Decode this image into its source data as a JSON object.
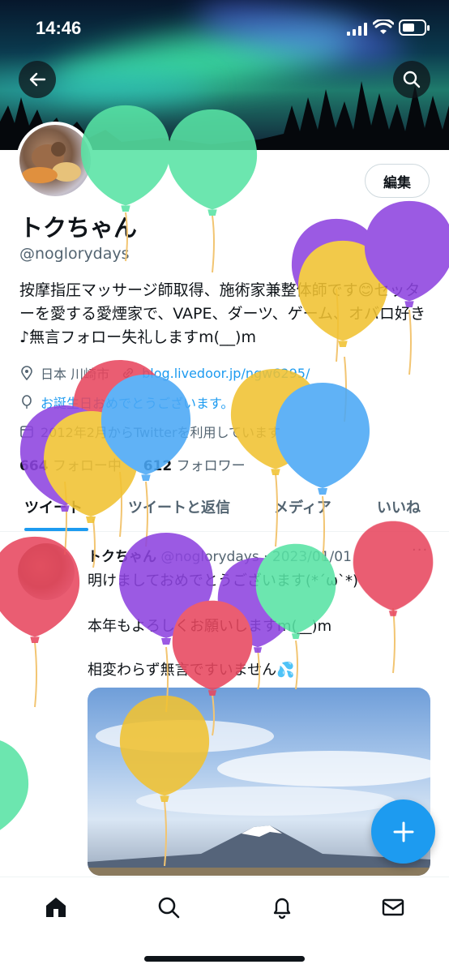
{
  "status_bar": {
    "time": "14:46"
  },
  "profile": {
    "edit_label": "編集",
    "name": "トクちゃん",
    "handle": "@noglorydays",
    "bio": "按摩指圧マッサージ師取得、施術家兼整体師です😊セッターを愛する愛煙家で、VAPE、ダーツ、ゲーム、オバロ好き♪無言フォロー失礼しますm(__)m",
    "location": "日本 川崎市",
    "website": "blog.livedoor.jp/ngw6295/",
    "birthday": "お誕生日おめでとうございます。",
    "joined": "2012年2月からTwitterを利用しています",
    "following_count": "664",
    "following_label": "フォロー中",
    "followers_count": "612",
    "followers_label": "フォロワー"
  },
  "tabs": [
    {
      "label": "ツイート"
    },
    {
      "label": "ツイートと返信"
    },
    {
      "label": "メディア"
    },
    {
      "label": "いいね"
    }
  ],
  "tweet": {
    "author": "トクちゃん",
    "handle": "@noglorydays",
    "date": "2023/01/01",
    "more": "···",
    "lines": [
      "明けましておめでとうございます(*´ω`*)",
      "本年もよろしくお願いしますm(__)m",
      "相変わらず無言ですいません💦"
    ]
  },
  "icons": {
    "back": "arrow-left-icon",
    "search": "search-icon",
    "location": "location-pin-icon",
    "link": "link-icon",
    "birthday": "balloon-icon",
    "calendar": "calendar-icon",
    "compose": "plus-icon",
    "nav": [
      "home-icon",
      "search-icon",
      "bell-icon",
      "mail-icon"
    ]
  },
  "colors": {
    "accent": "#1d9bf0",
    "text": "#0f1419",
    "muted": "#536471",
    "balloons": [
      "#8e44e0",
      "#f1c232",
      "#e8475f",
      "#4aa8f5",
      "#58e3a4"
    ]
  }
}
